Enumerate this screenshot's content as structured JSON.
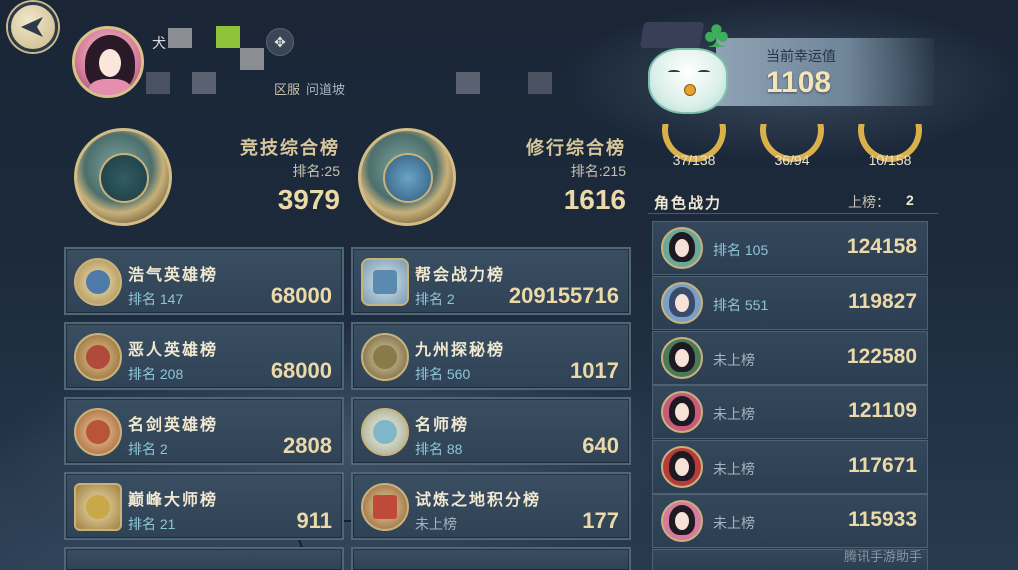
{
  "back": {
    "icon": "back-arrow-icon"
  },
  "profile": {
    "name_visible": "犬",
    "server_label": "区服",
    "server_name": "问道坡"
  },
  "overall": [
    {
      "title": "竞技综合榜",
      "rank_label": "排名:",
      "rank": "25",
      "score": "3979",
      "icon": "competition-medal-icon"
    },
    {
      "title": "修行综合榜",
      "rank_label": "排名:",
      "rank": "215",
      "score": "1616",
      "icon": "cultivation-medal-icon"
    }
  ],
  "cards": [
    {
      "title": "浩气英雄榜",
      "rank_text": "排名 147",
      "score": "68000",
      "icon": "righteous-hero-icon",
      "color": "#4d7aa8"
    },
    {
      "title": "帮会战力榜",
      "rank_text": "排名 2",
      "score": "209155716",
      "icon": "guild-power-icon",
      "color": "#5a8ab0"
    },
    {
      "title": "恶人英雄榜",
      "rank_text": "排名 208",
      "score": "68000",
      "icon": "villain-hero-icon",
      "color": "#b04a3a"
    },
    {
      "title": "九州探秘榜",
      "rank_text": "排名 560",
      "score": "1017",
      "icon": "exploration-icon",
      "color": "#8a7a4a"
    },
    {
      "title": "名剑英雄榜",
      "rank_text": "排名 2",
      "score": "2808",
      "icon": "famous-sword-icon",
      "color": "#b8543a"
    },
    {
      "title": "名师榜",
      "rank_text": "排名 88",
      "score": "640",
      "icon": "master-fan-icon",
      "color": "#7fb6c8"
    },
    {
      "title": "巅峰大师榜",
      "rank_text": "排名 21",
      "score": "911",
      "icon": "peak-master-icon",
      "color": "#c9a84a"
    },
    {
      "title": "试炼之地积分榜",
      "rank_text": "未上榜",
      "score": "177",
      "icon": "trial-ground-icon",
      "color": "#c04a3a",
      "unranked": true
    }
  ],
  "luck": {
    "label": "当前幸运值",
    "value": "1108"
  },
  "progress": [
    {
      "text": "37/138",
      "fraction": 0.268
    },
    {
      "text": "36/94",
      "fraction": 0.383
    },
    {
      "text": "10/158",
      "fraction": 0.063
    }
  ],
  "characters": {
    "title": "角色战力",
    "listed_label": "上榜：",
    "listed_count": "2",
    "rows": [
      {
        "rank_text": "排名 105",
        "power": "124158",
        "ranked": true,
        "accent": "#6aa89a"
      },
      {
        "rank_text": "排名 551",
        "power": "119827",
        "ranked": true,
        "accent": "#7aa0c8"
      },
      {
        "rank_text": "未上榜",
        "power": "122580",
        "ranked": false,
        "accent": "#4a7a58"
      },
      {
        "rank_text": "未上榜",
        "power": "121109",
        "ranked": false,
        "accent": "#c85a7a"
      },
      {
        "rank_text": "未上榜",
        "power": "117671",
        "ranked": false,
        "accent": "#b83a3a"
      },
      {
        "rank_text": "未上榜",
        "power": "115933",
        "ranked": false,
        "accent": "#d87aa0"
      }
    ]
  },
  "watermark": "腾讯手游助手"
}
